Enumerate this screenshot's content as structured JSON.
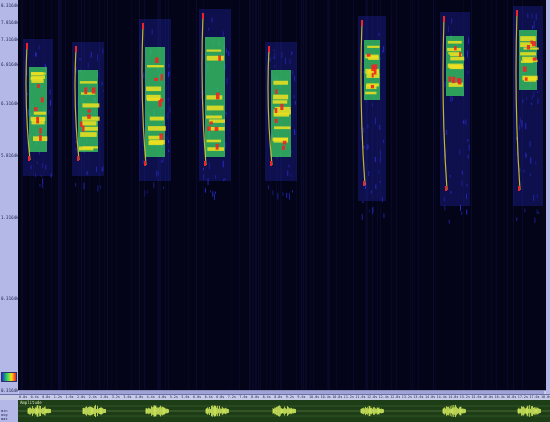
{
  "spectrogram": {
    "freq_ticks": [
      "8.3164k",
      "7.8164k",
      "7.3164k",
      "6.8164k",
      "6.3164k",
      "5.8164k",
      "1.3164k",
      "0.3164k"
    ],
    "freq_tick_partial": "0.3164k",
    "colors": {
      "background": "#030418",
      "low": "#2c2fd8",
      "mid": "#38d060",
      "high": "#f0e020",
      "peak": "#f02424"
    }
  },
  "time_ruler": {
    "ticks": [
      "0.0s",
      "0.4s",
      "0.8s",
      "1.2s",
      "1.6s",
      "2.0s",
      "2.4s",
      "2.8s",
      "3.2s",
      "3.6s",
      "4.0s",
      "4.4s",
      "4.8s",
      "5.2s",
      "5.6s",
      "6.0s",
      "6.4s",
      "6.8s",
      "7.2s",
      "7.6s",
      "8.0s",
      "8.4s",
      "8.8s",
      "9.2s",
      "9.6s",
      "10.0s",
      "10.4s",
      "10.8s",
      "11.2s",
      "11.6s",
      "12.0s",
      "12.4s",
      "12.8s",
      "13.2s",
      "13.6s",
      "14.0s",
      "14.4s",
      "14.8s",
      "15.2s",
      "15.6s",
      "16.0s",
      "16.4s",
      "16.8s",
      "17.2s",
      "17.6s",
      "18.0s"
    ]
  },
  "waveform": {
    "title": "Amplitude",
    "side_labels": [
      "min",
      "avg",
      "max"
    ],
    "colors": {
      "background": "#1d3d16",
      "wave": "#d8f060",
      "grid": "#4a6a3a"
    }
  }
}
